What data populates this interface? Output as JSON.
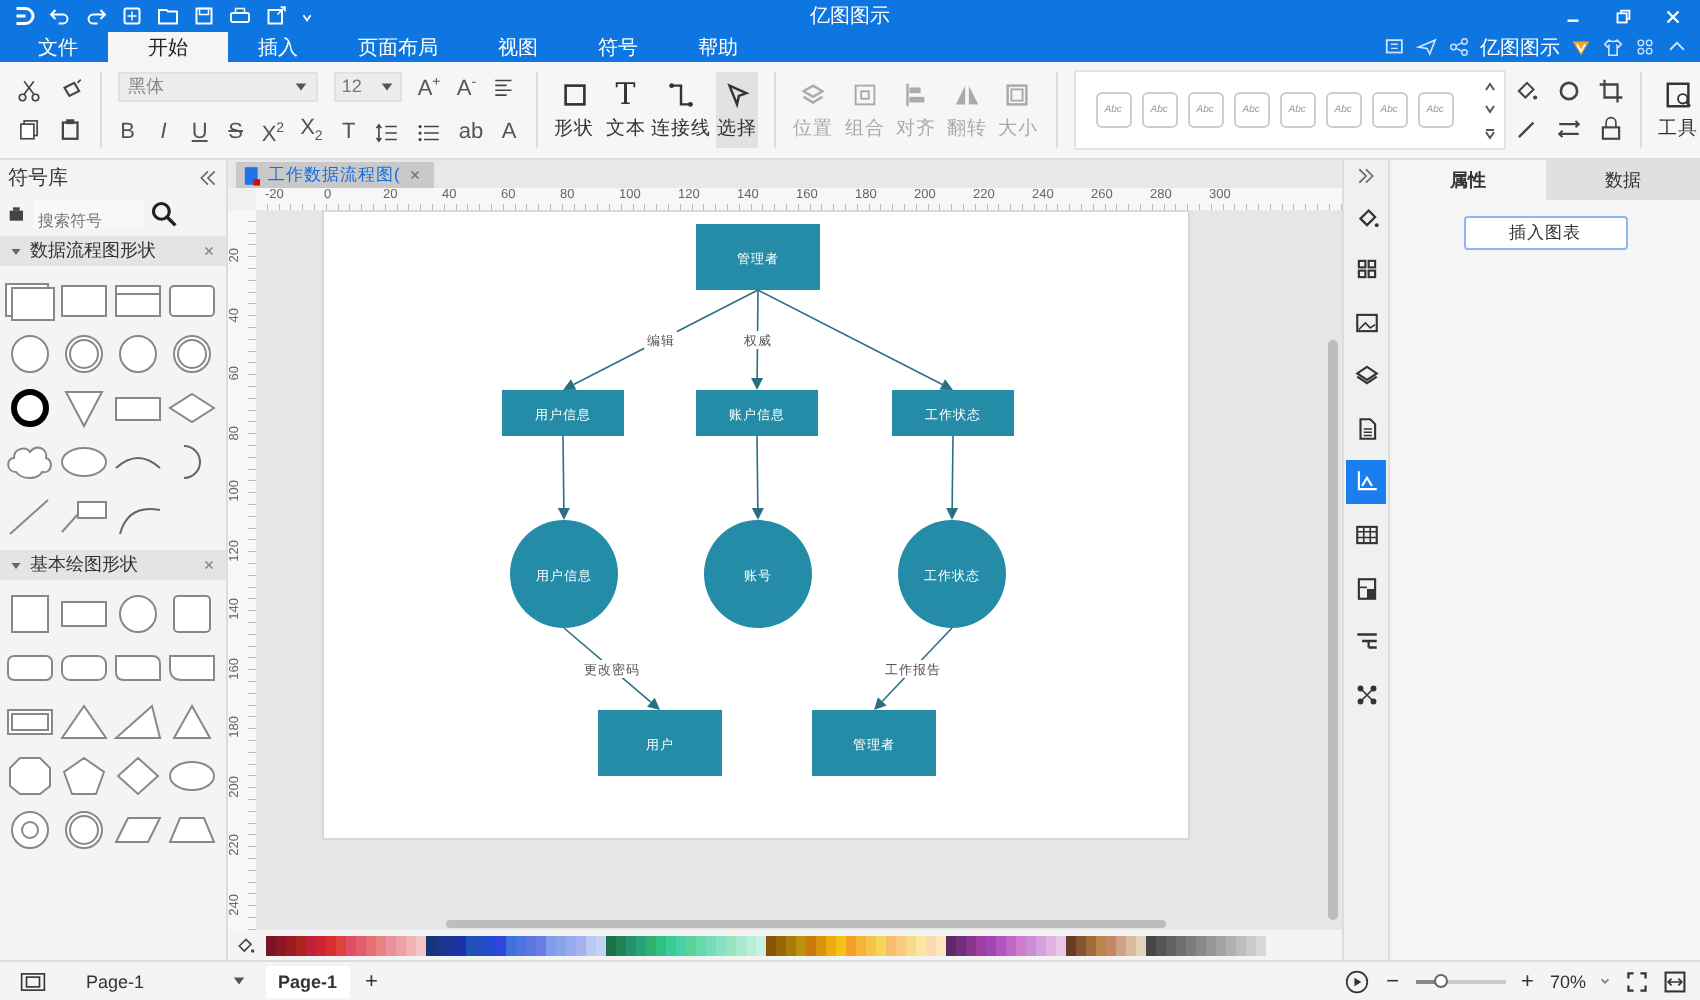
{
  "title_bar": {
    "title": "亿图图示"
  },
  "menu_tabs": [
    {
      "label": "文件",
      "selected": false
    },
    {
      "label": "开始",
      "selected": true
    },
    {
      "label": "插入",
      "selected": false
    },
    {
      "label": "页面布局",
      "selected": false
    },
    {
      "label": "视图",
      "selected": false
    },
    {
      "label": "符号",
      "selected": false
    },
    {
      "label": "帮助",
      "selected": false
    }
  ],
  "account": {
    "name": "亿图图示"
  },
  "ribbon": {
    "font": {
      "value": "黑体"
    },
    "size": {
      "value": "12"
    },
    "font_buttons": [
      "A$^{+}$",
      "A$^{-}$"
    ],
    "format_buttons": [
      "B",
      "I",
      "U",
      "S",
      "X$^{2}$",
      "X$_{2}$",
      "T",
      "ab",
      "A"
    ],
    "tools": [
      {
        "label": "形状",
        "selected": false
      },
      {
        "label": "文本",
        "glyph": "T",
        "selected": false
      },
      {
        "label": "连接线",
        "selected": false
      },
      {
        "label": "选择",
        "selected": true
      }
    ],
    "arrange": [
      {
        "label": "位置",
        "disabled": true
      },
      {
        "label": "组合",
        "disabled": true
      },
      {
        "label": "对齐",
        "disabled": true
      },
      {
        "label": "翻转",
        "disabled": true
      },
      {
        "label": "大小",
        "disabled": true
      }
    ],
    "styles": [
      "Abc",
      "Abc",
      "Abc",
      "Abc",
      "Abc",
      "Abc",
      "Abc",
      "Abc"
    ],
    "tools_menu": {
      "label": "工具"
    }
  },
  "library": {
    "title": "符号库",
    "search": {
      "placeholder": "搜索符号"
    },
    "sections": [
      {
        "title": "数据流程图形状",
        "expanded": true
      },
      {
        "title": "基本绘图形状",
        "expanded": true
      }
    ]
  },
  "document_tab": {
    "title": "工作数据流程图("
  },
  "rulers": {
    "horizontal": [
      "-20",
      "0",
      "20",
      "40",
      "60",
      "80",
      "100",
      "120",
      "140",
      "160",
      "180",
      "200",
      "220",
      "240",
      "260",
      "280",
      "300"
    ],
    "vertical": [
      "20",
      "40",
      "60",
      "80",
      "100",
      "120",
      "140",
      "160",
      "180",
      "200",
      "220",
      "240"
    ]
  },
  "diagram": {
    "nodes": [
      {
        "kind": "rect",
        "label": "管理者"
      },
      {
        "kind": "rect",
        "label": "用户信息"
      },
      {
        "kind": "rect",
        "label": "账户信息"
      },
      {
        "kind": "rect",
        "label": "工作状态"
      },
      {
        "kind": "circle",
        "label": "用户信息"
      },
      {
        "kind": "circle",
        "label": "账号"
      },
      {
        "kind": "circle",
        "label": "工作状态"
      },
      {
        "kind": "rect",
        "label": "用户"
      },
      {
        "kind": "rect",
        "label": "管理者"
      }
    ],
    "connector_labels": [
      "编辑",
      "权威",
      "更改密码",
      "工作报告"
    ]
  },
  "side_tools": [
    {
      "selected": false
    },
    {
      "selected": false
    },
    {
      "selected": false
    },
    {
      "selected": false
    },
    {
      "selected": false
    },
    {
      "selected": true
    },
    {
      "selected": false
    },
    {
      "selected": false
    },
    {
      "selected": false
    },
    {
      "selected": false
    }
  ],
  "right_panel": {
    "tabs": [
      {
        "label": "属性",
        "selected": true
      },
      {
        "label": "数据",
        "selected": false
      }
    ],
    "button": "插入图表"
  },
  "status_bar": {
    "page_select": "Page-1",
    "pages": [
      {
        "label": "Page-1",
        "selected": true
      }
    ],
    "add": "+",
    "zoom_out": "−",
    "zoom_in": "+",
    "zoom": {
      "level": 0.3,
      "reading": "70%"
    }
  }
}
